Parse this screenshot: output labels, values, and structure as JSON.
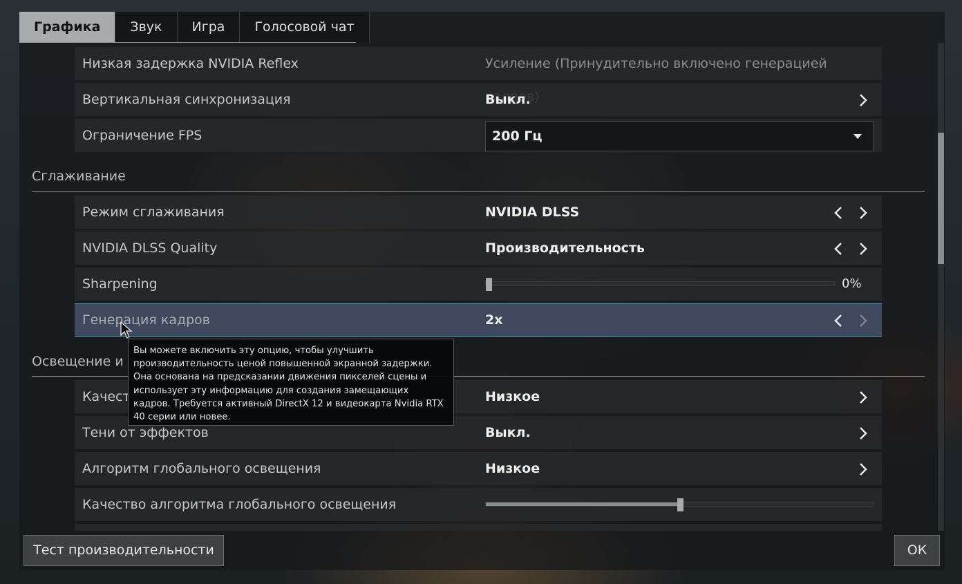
{
  "tabs": [
    "Графика",
    "Звук",
    "Игра",
    "Голосовой чат"
  ],
  "rows": {
    "reflex": {
      "label": "Низкая задержка NVIDIA Reflex",
      "value": "Усиление (Принудительно включено генерацией кадров)"
    },
    "vsync": {
      "label": "Вертикальная синхронизация",
      "value": "Выкл."
    },
    "fps": {
      "label": "Ограничение FPS",
      "value": "200 Гц"
    },
    "aa_mode": {
      "label": "Режим сглаживания",
      "value": "NVIDIA DLSS"
    },
    "dlss_quality": {
      "label": "NVIDIA DLSS Quality",
      "value": "Производительность"
    },
    "sharpening": {
      "label": "Sharpening",
      "value": "0%",
      "level": 0
    },
    "framegen": {
      "label": "Генерация кадров",
      "value": "2x"
    },
    "quality": {
      "label": "Качест",
      "value": "Низкое"
    },
    "effect_shadows": {
      "label": "Тени от эффектов",
      "value": "Выкл."
    },
    "gi_algo": {
      "label": "Алгоритм глобального освещения",
      "value": "Низкое"
    },
    "gi_quality": {
      "label": "Качество алгоритма глобального освещения",
      "level": 0.5
    }
  },
  "sections": {
    "antialiasing": "Сглаживание",
    "lighting": "Освещение и т"
  },
  "tooltip": {
    "text": "Вы можете включить эту опцию, чтобы улучшить производительность ценой повышенной экранной задержки. Она основана на предсказании движения пикселей сцены и использует эту информацию для создания замещающих кадров. Требуется активный DirectX 12 и видеокарта Nvidia RTX 40 серии или новее."
  },
  "buttons": {
    "benchmark": "Тест производительности",
    "ok": "ОК"
  },
  "colors": {
    "highlight_border": "#4aa3c8",
    "active_tab": "#a9acae"
  }
}
